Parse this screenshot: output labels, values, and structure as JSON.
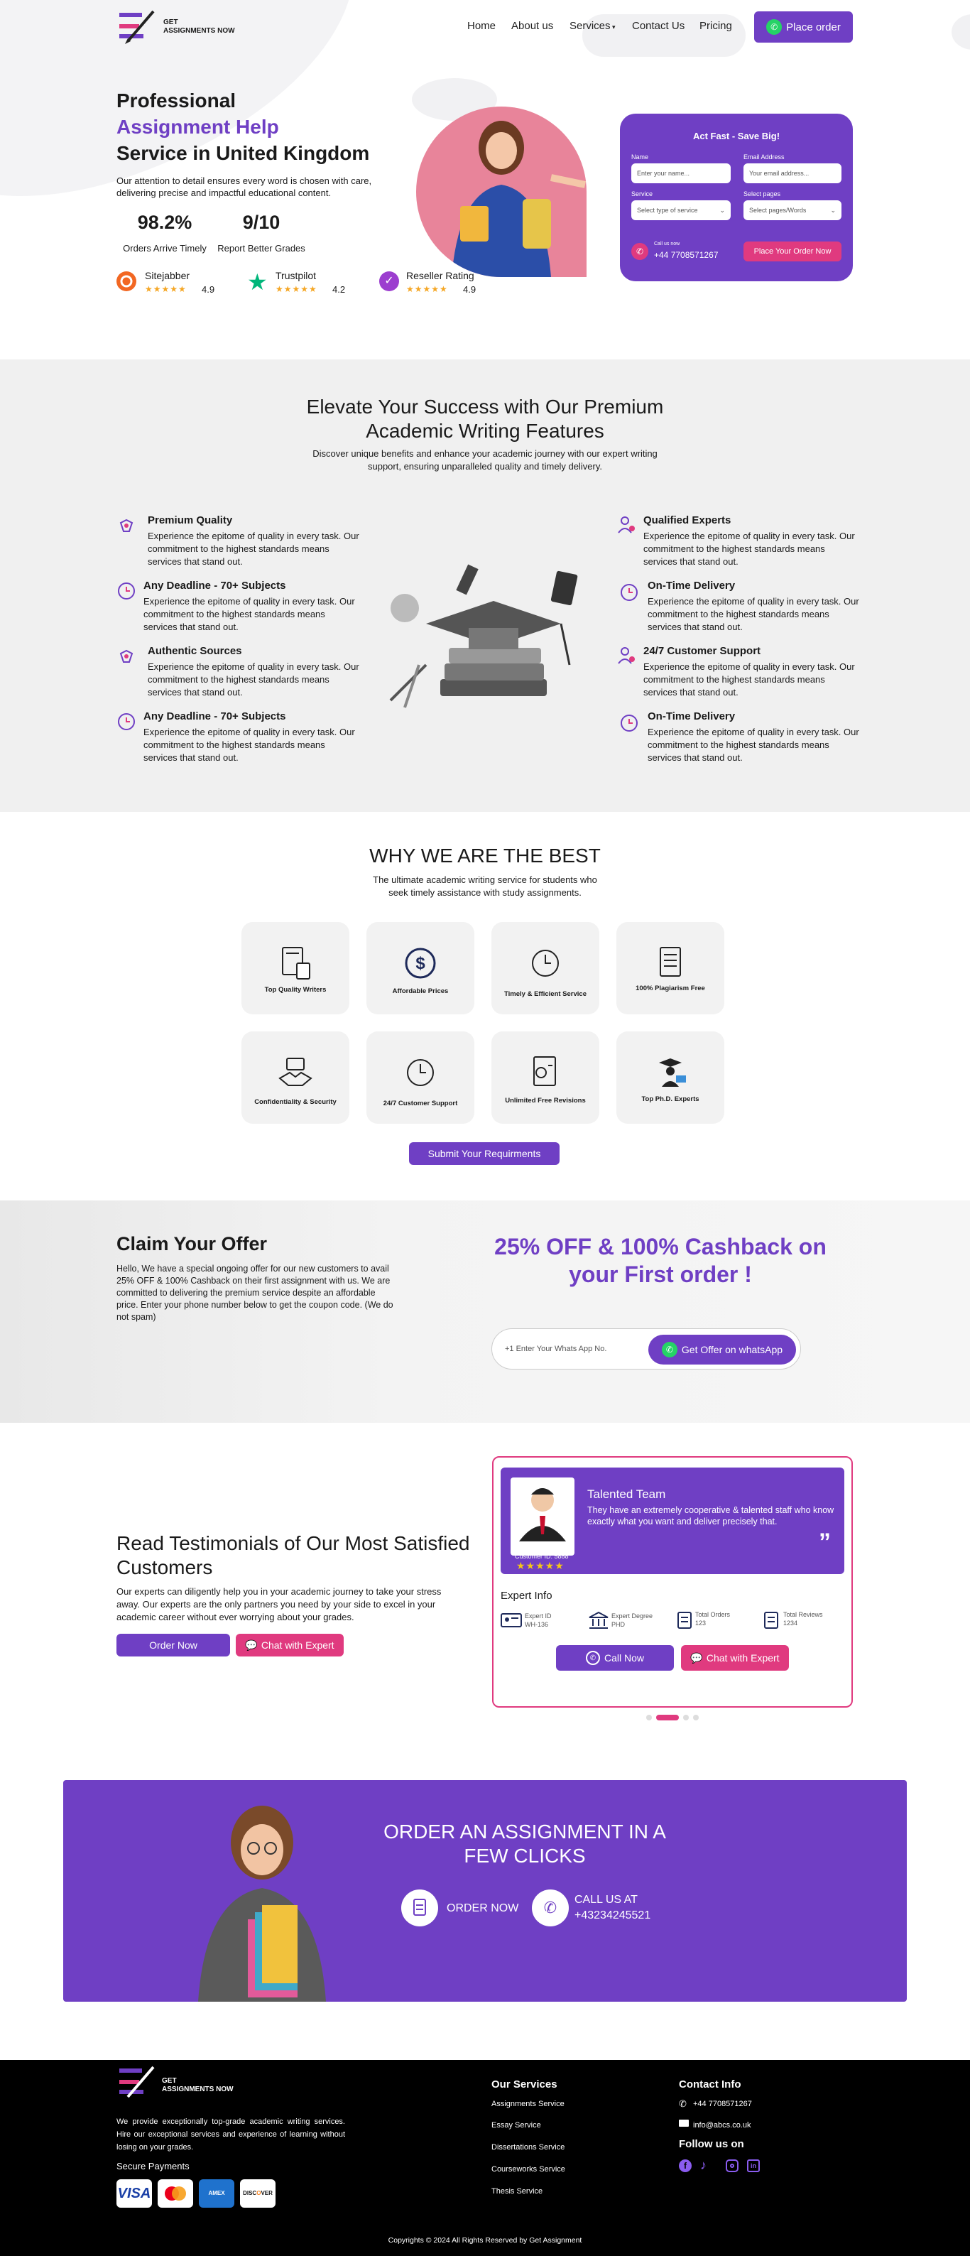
{
  "header": {
    "logo_line1": "GET",
    "logo_line2": "ASSIGNMENTS NOW",
    "nav": [
      "Home",
      "About us",
      "Services",
      "Contact Us",
      "Pricing"
    ],
    "place_order": "Place order"
  },
  "hero": {
    "line1": "Professional",
    "line2": "Assignment Help",
    "line3": "Service in United Kingdom",
    "desc": "Our attention to detail ensures every word is chosen with care, delivering precise and impactful educational content.",
    "stats": [
      {
        "value": "98.2%",
        "label": "Orders Arrive Timely"
      },
      {
        "value": "9/10",
        "label": "Report Better Grades"
      }
    ],
    "reviews": [
      {
        "name": "Sitejabber",
        "score": "4.9",
        "color": "#f26722"
      },
      {
        "name": "Trustpilot",
        "score": "4.2",
        "color": "#00b67a"
      },
      {
        "name": "Reseller Rating",
        "score": "4.9",
        "color": "#9c3ecf"
      }
    ],
    "stars": "★★★★★"
  },
  "form": {
    "title": "Act Fast - Save Big!",
    "name_label": "Name",
    "name_ph": "Enter your name...",
    "email_label": "Email Address",
    "email_ph": "Your email address...",
    "service_label": "Service",
    "service_ph": "Select type of service",
    "pages_label": "Select pages",
    "pages_ph": "Select pages/Words",
    "call_label": "Call us now",
    "phone": "+44 7708571267",
    "submit": "Place Your Order Now"
  },
  "features": {
    "title1": "Elevate Your Success with Our Premium",
    "title2": "Academic Writing Features",
    "desc1": "Discover unique benefits and enhance your academic journey with our expert writing",
    "desc2": "support, ensuring unparalleled quality and timely delivery.",
    "items_left": [
      {
        "title": "Premium Quality",
        "desc": "Experience the epitome of quality in every task. Our commitment to the highest standards means services that stand out."
      },
      {
        "title": "Any Deadline - 70+ Subjects",
        "desc": "Experience the epitome of quality in every task. Our commitment to the highest standards means services that stand out."
      },
      {
        "title": "Authentic Sources",
        "desc": "Experience the epitome of quality in every task. Our commitment to the highest standards means services that stand out."
      },
      {
        "title": "Any Deadline - 70+ Subjects",
        "desc": "Experience the epitome of quality in every task. Our commitment to the highest standards means services that stand out."
      }
    ],
    "items_right": [
      {
        "title": "Qualified Experts",
        "desc": "Experience the epitome of quality in every task. Our commitment to the highest standards means services that stand out."
      },
      {
        "title": "On-Time Delivery",
        "desc": "Experience the epitome of quality in every task. Our commitment to the highest standards means services that stand out."
      },
      {
        "title": "24/7 Customer Support",
        "desc": "Experience the epitome of quality in every task. Our commitment to the highest standards means services that stand out."
      },
      {
        "title": "On-Time Delivery",
        "desc": "Experience the epitome of quality in every task. Our commitment to the highest standards means services that stand out."
      }
    ]
  },
  "why": {
    "title": "WHY WE ARE THE BEST",
    "desc1": "The ultimate academic writing service for students who",
    "desc2": "seek timely assistance with study assignments.",
    "cards": [
      "Top Quality Writers",
      "Affordable Prices",
      "Timely & Efficient Service",
      "100% Plagiarism Free",
      "Confidentiality & Security",
      "24/7 Customer Support",
      "Unlimited Free Revisions",
      "Top Ph.D. Experts"
    ],
    "button": "Submit Your Requirments"
  },
  "offer": {
    "title": "Claim Your Offer",
    "desc": "Hello, We have a special ongoing offer for our new customers to avail 25% OFF & 100% Cashback on their first assignment with us. We are committed to delivering the premium service despite an affordable price. Enter your phone number below to get the coupon code. (We do not spam)",
    "headline1": "25% OFF & 100% Cashback on",
    "headline2": "your First order !",
    "input_ph": "+1 Enter Your Whats App No.",
    "button": "Get Offer on whatsApp"
  },
  "testimonials": {
    "title1": "Read Testimonials of Our Most Satisfied",
    "title2": "Customers",
    "desc": "Our experts can diligently help you in your academic journey to take your stress away. Our experts are the only partners you need by your side to excel in your academic career without ever worrying about your grades.",
    "order_btn": "Order Now",
    "chat_btn": "Chat with Expert",
    "card": {
      "team": "Talented Team",
      "quote": "They have an extremely cooperative & talented staff who know exactly what you want and deliver precisely that.",
      "customer_id": "Customer ID: 5888",
      "expert_info": "Expert Info",
      "expert_id_label": "Expert ID",
      "expert_id": "WH-136",
      "degree_label": "Expert Degree",
      "degree": "PHD",
      "orders_label": "Total Orders",
      "orders": "123",
      "reviews_label": "Total Reviews",
      "reviews": "1234",
      "call_btn": "Call Now",
      "chat_btn": "Chat with Expert"
    }
  },
  "cta": {
    "title1": "ORDER AN ASSIGNMENT IN A",
    "title2": "FEW CLICKS",
    "order": "ORDER NOW",
    "call1": "CALL US AT",
    "call2": "+43234245521"
  },
  "footer": {
    "desc": "We provide exceptionally top-grade academic writing services. Hire our exceptional services and experience of learning without losing on your grades.",
    "secure": "Secure Payments",
    "cards": [
      "VISA",
      "MC",
      "AMEX",
      "DISCOVER"
    ],
    "services_title": "Our Services",
    "services": [
      "Assignments Service",
      "Essay Service",
      "Dissertations Service",
      "Courseworks Service",
      "Thesis Service"
    ],
    "contact_title": "Contact Info",
    "phone": "+44 7708571267",
    "email": "info@abcs.co.uk",
    "follow": "Follow us on",
    "copyright": "Copyrights © 2024 All Rights Reserved by Get Assignment"
  },
  "colors": {
    "primary": "#6f3fc4",
    "pink": "#e03a7f",
    "dark": "#000000"
  }
}
